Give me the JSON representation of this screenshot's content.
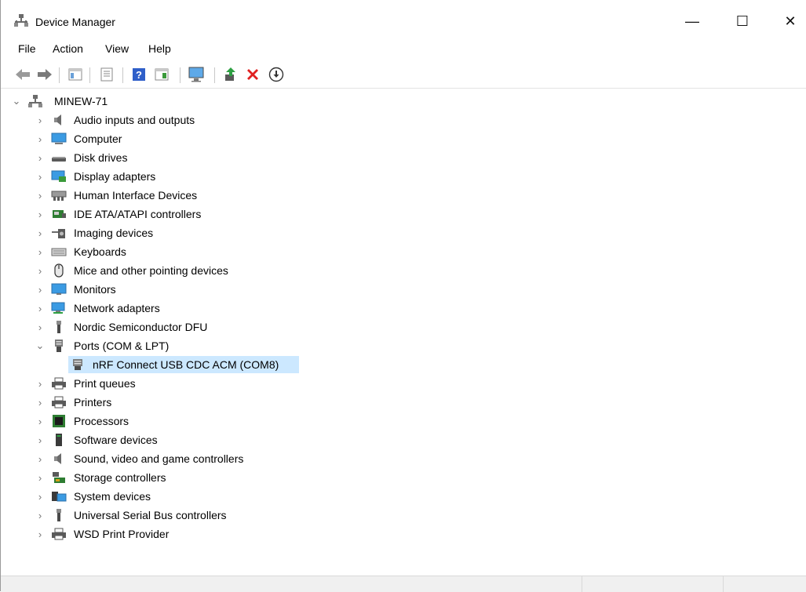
{
  "window": {
    "title": "Device Manager",
    "minimize_glyph": "—",
    "maximize_glyph": "☐",
    "close_glyph": "✕"
  },
  "menu": [
    "File",
    "Action",
    "View",
    "Help"
  ],
  "toolbar": {
    "icons": [
      "back-arrow-icon",
      "forward-arrow-icon",
      "properties-pane-icon",
      "device-properties-icon",
      "help-icon",
      "show-hidden-icon",
      "monitor-scan-icon",
      "update-driver-icon",
      "uninstall-icon",
      "disable-device-icon"
    ]
  },
  "tree": {
    "root": "MINEW-71",
    "categories": [
      {
        "label": "Audio inputs and outputs",
        "icon": "speaker-icon",
        "expanded": false
      },
      {
        "label": "Computer",
        "icon": "computer-icon",
        "expanded": false
      },
      {
        "label": "Disk drives",
        "icon": "disk-drive-icon",
        "expanded": false
      },
      {
        "label": "Display adapters",
        "icon": "display-adapter-icon",
        "expanded": false
      },
      {
        "label": "Human Interface Devices",
        "icon": "hid-icon",
        "expanded": false
      },
      {
        "label": "IDE ATA/ATAPI controllers",
        "icon": "ide-controller-icon",
        "expanded": false
      },
      {
        "label": "Imaging devices",
        "icon": "camera-icon",
        "expanded": false
      },
      {
        "label": "Keyboards",
        "icon": "keyboard-icon",
        "expanded": false
      },
      {
        "label": "Mice and other pointing devices",
        "icon": "mouse-icon",
        "expanded": false
      },
      {
        "label": "Monitors",
        "icon": "monitor-icon",
        "expanded": false
      },
      {
        "label": "Network adapters",
        "icon": "network-adapter-icon",
        "expanded": false
      },
      {
        "label": "Nordic Semiconductor DFU",
        "icon": "usb-plug-icon",
        "expanded": false
      },
      {
        "label": "Ports (COM & LPT)",
        "icon": "port-icon",
        "expanded": true,
        "children": [
          {
            "label": "nRF Connect USB CDC ACM (COM8)",
            "icon": "port-icon",
            "selected": true
          }
        ]
      },
      {
        "label": "Print queues",
        "icon": "printer-icon",
        "expanded": false
      },
      {
        "label": "Printers",
        "icon": "printer-icon",
        "expanded": false
      },
      {
        "label": "Processors",
        "icon": "processor-icon",
        "expanded": false
      },
      {
        "label": "Software devices",
        "icon": "software-device-icon",
        "expanded": false
      },
      {
        "label": "Sound, video and game controllers",
        "icon": "speaker-icon",
        "expanded": false
      },
      {
        "label": "Storage controllers",
        "icon": "storage-controller-icon",
        "expanded": false
      },
      {
        "label": "System devices",
        "icon": "system-devices-icon",
        "expanded": false
      },
      {
        "label": "Universal Serial Bus controllers",
        "icon": "usb-plug-icon",
        "expanded": false
      },
      {
        "label": "WSD Print Provider",
        "icon": "printer-icon",
        "expanded": false
      }
    ]
  },
  "colors": {
    "selection": "#cce8ff",
    "accent": "#0078d7",
    "uninstall_red": "#e02020"
  }
}
